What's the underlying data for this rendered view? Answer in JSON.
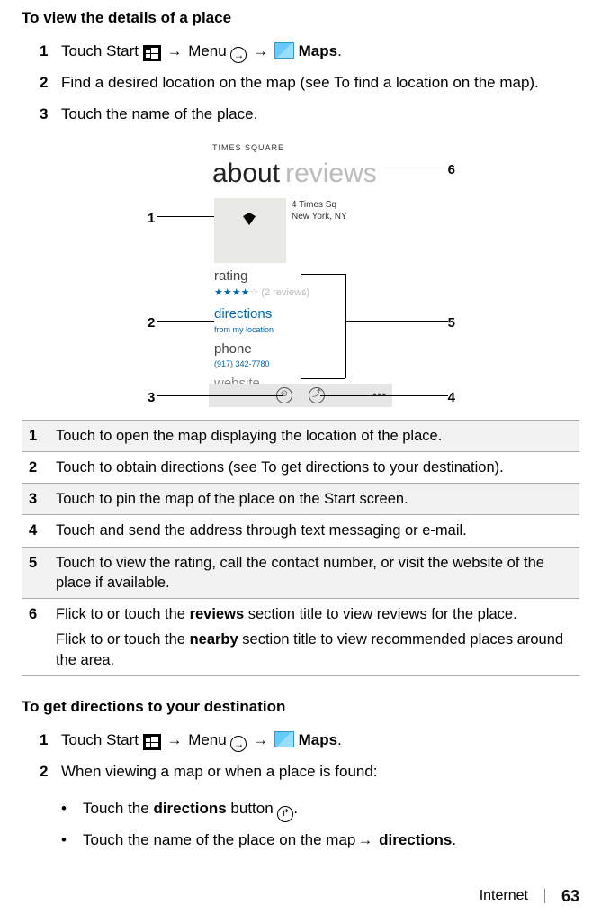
{
  "section1": {
    "title": "To view the details of a place",
    "step1": {
      "num": "1",
      "text1": "Touch Start ",
      "menu": " Menu ",
      "maps": " Maps",
      "period": "."
    },
    "step2": {
      "num": "2",
      "text": "Find a desired location on the map (see To find a location on the map)."
    },
    "step3": {
      "num": "3",
      "text": "Touch the name of the place."
    }
  },
  "figure": {
    "loc": "TIMES SQUARE",
    "tab_about": "about",
    "tab_reviews": "reviews",
    "addr1": "4 Times Sq",
    "addr2": "New York, NY",
    "rating_lbl": "rating",
    "rating_sub": "(2 reviews)",
    "dir_lbl": "directions",
    "dir_sub": "from my location",
    "phone_lbl": "phone",
    "phone_sub": "(917) 342-7780",
    "web_lbl": "website",
    "callouts": {
      "c1": "1",
      "c2": "2",
      "c3": "3",
      "c4": "4",
      "c5": "5",
      "c6": "6"
    }
  },
  "table": {
    "r1": {
      "n": "1",
      "t": "Touch to open the map displaying the location of the place."
    },
    "r2": {
      "n": "2",
      "t": "Touch to obtain directions (see To get directions to your destination)."
    },
    "r3": {
      "n": "3",
      "t": "Touch to pin the map of the place on the Start screen."
    },
    "r4": {
      "n": "4",
      "t": "Touch and send the address through text messaging or e-mail."
    },
    "r5": {
      "n": "5",
      "t": "Touch to view the rating, call the contact number, or visit the website of the place if available."
    },
    "r6": {
      "n": "6",
      "t1a": "Flick to or touch the ",
      "t1b": "reviews",
      "t1c": " section title to view reviews for the place.",
      "t2a": "Flick to or touch the ",
      "t2b": "nearby",
      "t2c": " section title to view recommended places around the area."
    }
  },
  "section2": {
    "title": "To get directions to your destination",
    "step1": {
      "num": "1",
      "text1": "Touch Start ",
      "menu": " Menu ",
      "maps": " Maps",
      "period": "."
    },
    "step2": {
      "num": "2",
      "text": "When viewing a map or when a place is found:"
    },
    "b1": {
      "a": "Touch the ",
      "b": "directions",
      "c": " button ",
      "d": "."
    },
    "b2": {
      "a": "Touch the name of the place on the map",
      "b": " directions",
      "c": "."
    }
  },
  "footer": {
    "section": "Internet",
    "page": "63"
  },
  "glyphs": {
    "right_arrow": "→",
    "bullet": "•"
  }
}
